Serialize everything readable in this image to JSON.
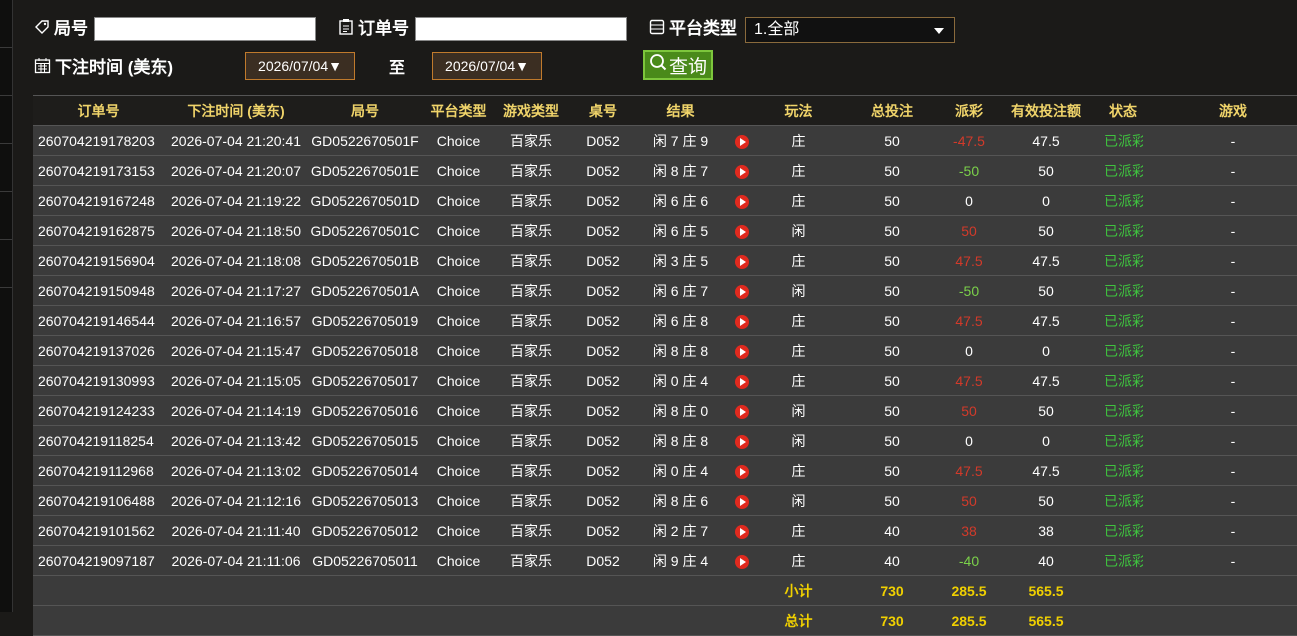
{
  "filters": {
    "round_label": "局号",
    "order_label": "订单号",
    "platform_label": "平台类型",
    "platform_value": "1.全部",
    "time_label": "下注时间 (美东)",
    "date_from": "2026/07/04▼",
    "to_label": "至",
    "date_to": "2026/07/04▼",
    "query_label": "查询"
  },
  "columns": [
    "订单号",
    "下注时间 (美东)",
    "局号",
    "平台类型",
    "游戏类型",
    "桌号",
    "结果",
    "",
    "玩法",
    "总投注",
    "派彩",
    "有效投注额",
    "状态",
    "游戏"
  ],
  "rows": [
    {
      "order": "260704219178203",
      "time": "2026-07-04 21:20:41",
      "round": "GD0522670501F",
      "platform": "Choice",
      "game": "百家乐",
      "table": "D052",
      "result": "闲 7 庄 9",
      "bet": "庄",
      "total": "50",
      "payout": "-47.5",
      "payout_color": "red",
      "valid": "47.5",
      "status": "已派彩"
    },
    {
      "order": "260704219173153",
      "time": "2026-07-04 21:20:07",
      "round": "GD0522670501E",
      "platform": "Choice",
      "game": "百家乐",
      "table": "D052",
      "result": "闲 8 庄 7",
      "bet": "庄",
      "total": "50",
      "payout": "-50",
      "payout_color": "green",
      "valid": "50",
      "status": "已派彩"
    },
    {
      "order": "260704219167248",
      "time": "2026-07-04 21:19:22",
      "round": "GD0522670501D",
      "platform": "Choice",
      "game": "百家乐",
      "table": "D052",
      "result": "闲 6 庄 6",
      "bet": "庄",
      "total": "50",
      "payout": "0",
      "payout_color": "white",
      "valid": "0",
      "status": "已派彩"
    },
    {
      "order": "260704219162875",
      "time": "2026-07-04 21:18:50",
      "round": "GD0522670501C",
      "platform": "Choice",
      "game": "百家乐",
      "table": "D052",
      "result": "闲 6 庄 5",
      "bet": "闲",
      "total": "50",
      "payout": "50",
      "payout_color": "red",
      "valid": "50",
      "status": "已派彩"
    },
    {
      "order": "260704219156904",
      "time": "2026-07-04 21:18:08",
      "round": "GD0522670501B",
      "platform": "Choice",
      "game": "百家乐",
      "table": "D052",
      "result": "闲 3 庄 5",
      "bet": "庄",
      "total": "50",
      "payout": "47.5",
      "payout_color": "red",
      "valid": "47.5",
      "status": "已派彩"
    },
    {
      "order": "260704219150948",
      "time": "2026-07-04 21:17:27",
      "round": "GD0522670501A",
      "platform": "Choice",
      "game": "百家乐",
      "table": "D052",
      "result": "闲 6 庄 7",
      "bet": "闲",
      "total": "50",
      "payout": "-50",
      "payout_color": "green",
      "valid": "50",
      "status": "已派彩"
    },
    {
      "order": "260704219146544",
      "time": "2026-07-04 21:16:57",
      "round": "GD05226705019",
      "platform": "Choice",
      "game": "百家乐",
      "table": "D052",
      "result": "闲 6 庄 8",
      "bet": "庄",
      "total": "50",
      "payout": "47.5",
      "payout_color": "red",
      "valid": "47.5",
      "status": "已派彩"
    },
    {
      "order": "260704219137026",
      "time": "2026-07-04 21:15:47",
      "round": "GD05226705018",
      "platform": "Choice",
      "game": "百家乐",
      "table": "D052",
      "result": "闲 8 庄 8",
      "bet": "庄",
      "total": "50",
      "payout": "0",
      "payout_color": "white",
      "valid": "0",
      "status": "已派彩"
    },
    {
      "order": "260704219130993",
      "time": "2026-07-04 21:15:05",
      "round": "GD05226705017",
      "platform": "Choice",
      "game": "百家乐",
      "table": "D052",
      "result": "闲 0 庄 4",
      "bet": "庄",
      "total": "50",
      "payout": "47.5",
      "payout_color": "red",
      "valid": "47.5",
      "status": "已派彩"
    },
    {
      "order": "260704219124233",
      "time": "2026-07-04 21:14:19",
      "round": "GD05226705016",
      "platform": "Choice",
      "game": "百家乐",
      "table": "D052",
      "result": "闲 8 庄 0",
      "bet": "闲",
      "total": "50",
      "payout": "50",
      "payout_color": "red",
      "valid": "50",
      "status": "已派彩"
    },
    {
      "order": "260704219118254",
      "time": "2026-07-04 21:13:42",
      "round": "GD05226705015",
      "platform": "Choice",
      "game": "百家乐",
      "table": "D052",
      "result": "闲 8 庄 8",
      "bet": "闲",
      "total": "50",
      "payout": "0",
      "payout_color": "white",
      "valid": "0",
      "status": "已派彩"
    },
    {
      "order": "260704219112968",
      "time": "2026-07-04 21:13:02",
      "round": "GD05226705014",
      "platform": "Choice",
      "game": "百家乐",
      "table": "D052",
      "result": "闲 0 庄 4",
      "bet": "庄",
      "total": "50",
      "payout": "47.5",
      "payout_color": "red",
      "valid": "47.5",
      "status": "已派彩"
    },
    {
      "order": "260704219106488",
      "time": "2026-07-04 21:12:16",
      "round": "GD05226705013",
      "platform": "Choice",
      "game": "百家乐",
      "table": "D052",
      "result": "闲 8 庄 6",
      "bet": "闲",
      "total": "50",
      "payout": "50",
      "payout_color": "red",
      "valid": "50",
      "status": "已派彩"
    },
    {
      "order": "260704219101562",
      "time": "2026-07-04 21:11:40",
      "round": "GD05226705012",
      "platform": "Choice",
      "game": "百家乐",
      "table": "D052",
      "result": "闲 2 庄 7",
      "bet": "庄",
      "total": "40",
      "payout": "38",
      "payout_color": "red",
      "valid": "38",
      "status": "已派彩"
    },
    {
      "order": "260704219097187",
      "time": "2026-07-04 21:11:06",
      "round": "GD05226705011",
      "platform": "Choice",
      "game": "百家乐",
      "table": "D052",
      "result": "闲 9 庄 4",
      "bet": "庄",
      "total": "40",
      "payout": "-40",
      "payout_color": "green",
      "valid": "40",
      "status": "已派彩"
    }
  ],
  "row_trailing": "-",
  "subtotal": {
    "label": "小计",
    "total": "730",
    "payout": "285.5",
    "valid": "565.5"
  },
  "grandtotal": {
    "label": "总计",
    "total": "730",
    "payout": "285.5",
    "valid": "565.5"
  }
}
